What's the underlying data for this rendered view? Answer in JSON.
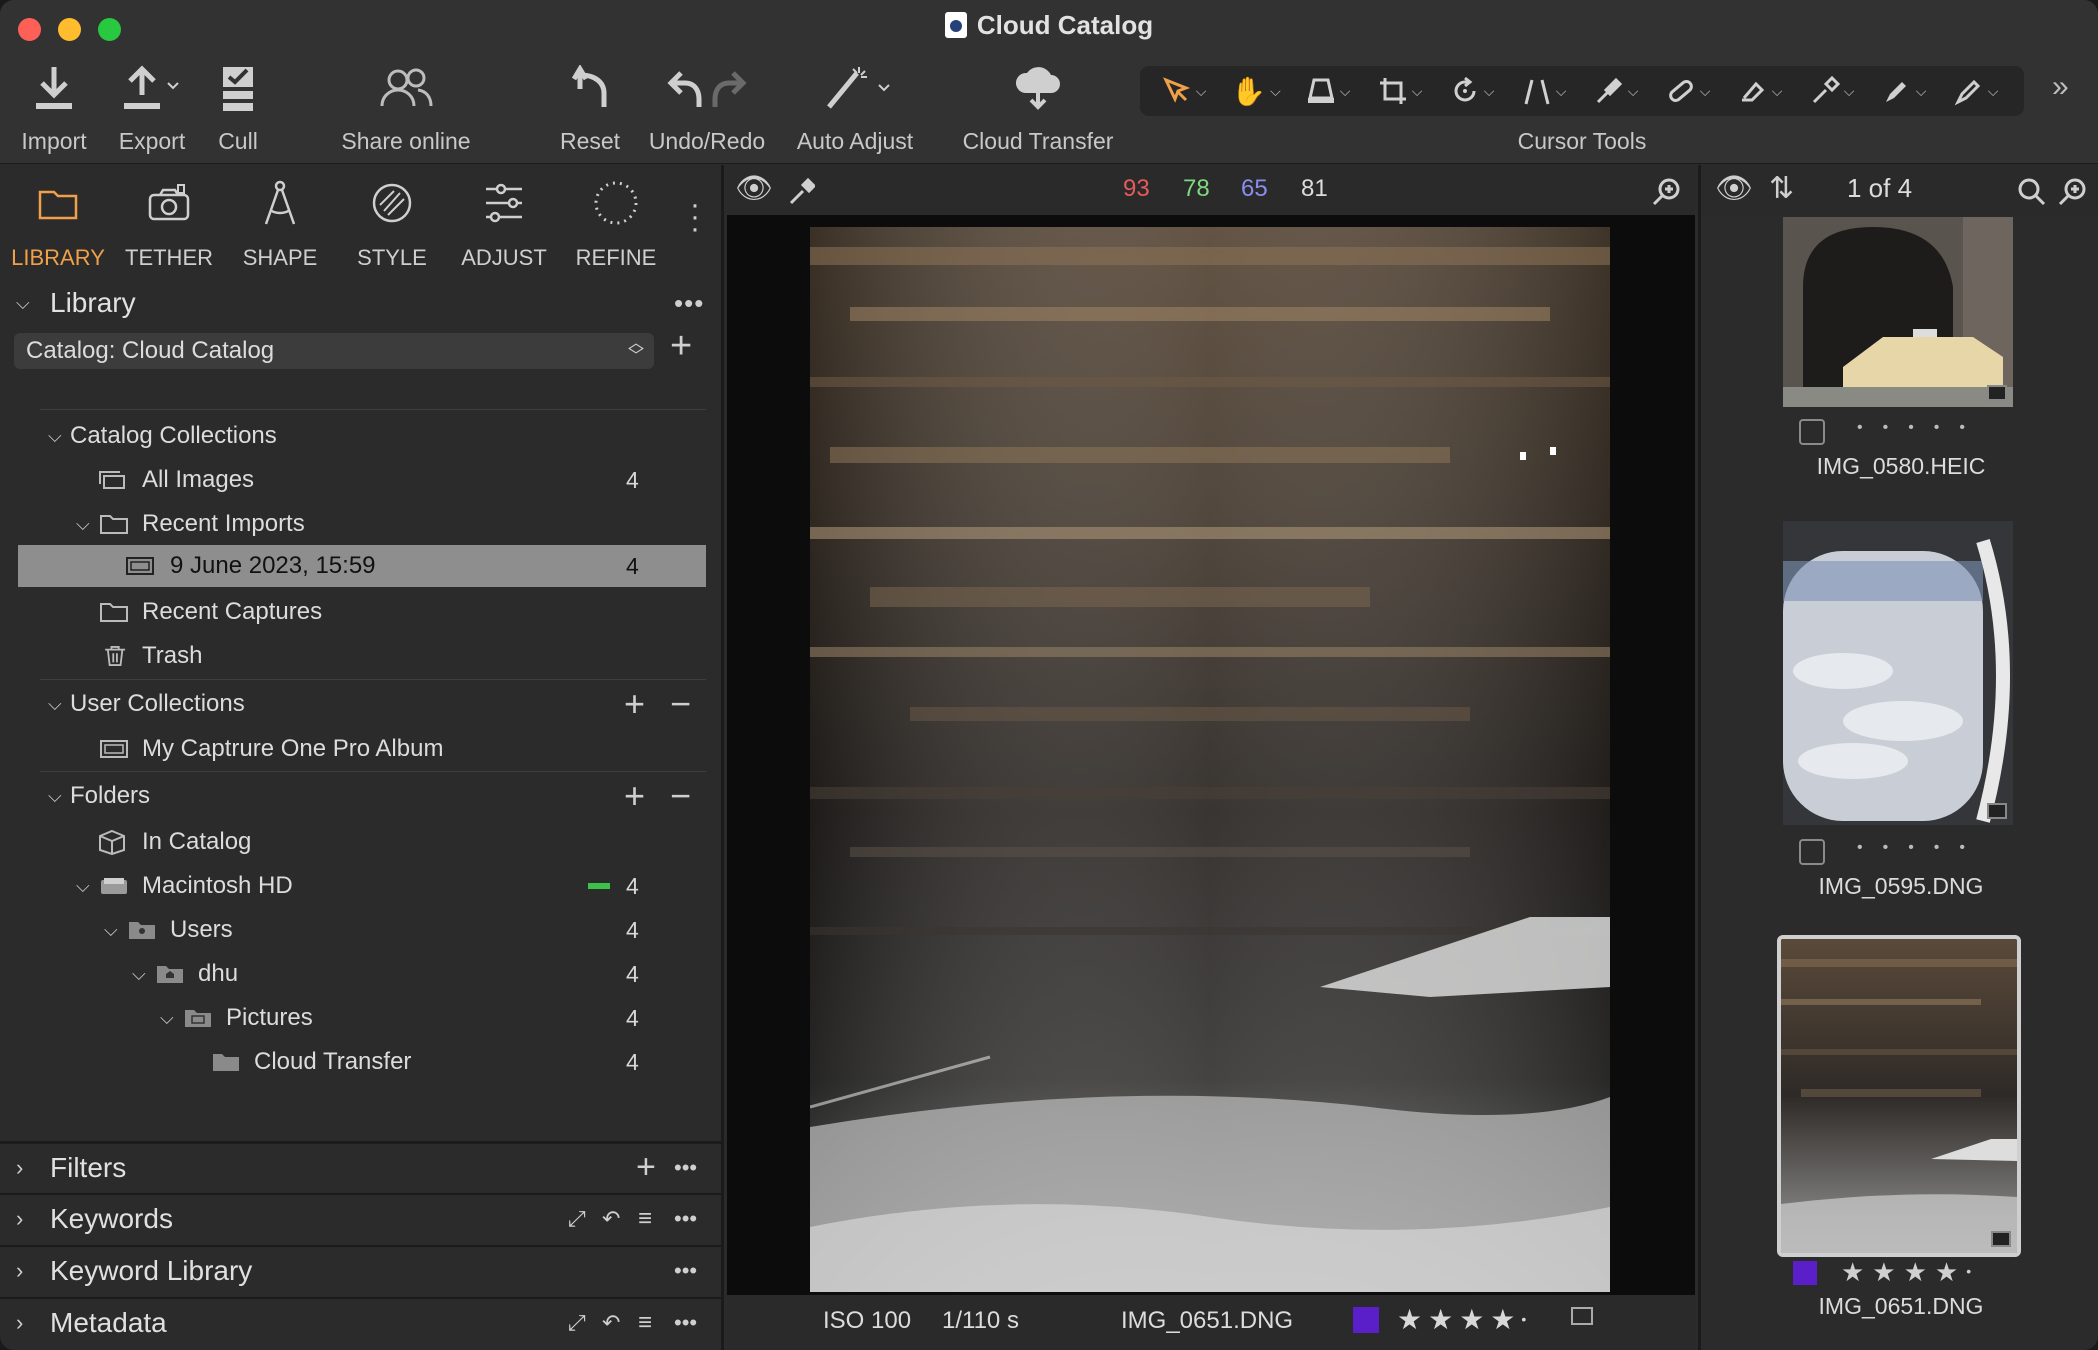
{
  "window": {
    "title": "Cloud Catalog"
  },
  "toolbar": {
    "import": "Import",
    "export": "Export",
    "cull": "Cull",
    "share": "Share online",
    "reset": "Reset",
    "undo_redo": "Undo/Redo",
    "auto_adjust": "Auto Adjust",
    "cloud_transfer": "Cloud Transfer",
    "cursor_tools": "Cursor Tools"
  },
  "tool_tabs": [
    "LIBRARY",
    "TETHER",
    "SHAPE",
    "STYLE",
    "ADJUST",
    "REFINE"
  ],
  "library": {
    "header": "Library",
    "catalog_select": "Catalog: Cloud Catalog",
    "catalog_collections": "Catalog Collections",
    "all_images": {
      "label": "All Images",
      "count": "4"
    },
    "recent_imports": "Recent Imports",
    "import_session": {
      "label": "9 June 2023, 15:59",
      "count": "4"
    },
    "recent_captures": "Recent Captures",
    "trash": "Trash",
    "user_collections": "User Collections",
    "album": "My Captrure One Pro Album",
    "folders": "Folders",
    "in_catalog": "In Catalog",
    "tree": [
      {
        "label": "Macintosh HD",
        "count": "4"
      },
      {
        "label": "Users",
        "count": "4"
      },
      {
        "label": "dhu",
        "count": "4"
      },
      {
        "label": "Pictures",
        "count": "4"
      },
      {
        "label": "Cloud Transfer",
        "count": "4"
      }
    ]
  },
  "sections": {
    "filters": "Filters",
    "keywords": "Keywords",
    "keyword_library": "Keyword Library",
    "metadata": "Metadata"
  },
  "viewer": {
    "rgb": {
      "r": "93",
      "g": "78",
      "b": "65",
      "l": "81"
    },
    "iso": "ISO 100",
    "shutter": "1/110 s",
    "filename": "IMG_0651.DNG",
    "rating_stars": 4,
    "color_tag": "#5a1fc9"
  },
  "browser": {
    "counter": "1 of 4",
    "items": [
      {
        "name": "IMG_0580.HEIC",
        "stars": 0
      },
      {
        "name": "IMG_0595.DNG",
        "stars": 0
      },
      {
        "name": "IMG_0651.DNG",
        "stars": 4
      }
    ]
  },
  "colors": {
    "accent": "#f0a048",
    "red": "#e85a5a",
    "green": "#7fd77f",
    "blue": "#8a8cf0"
  }
}
